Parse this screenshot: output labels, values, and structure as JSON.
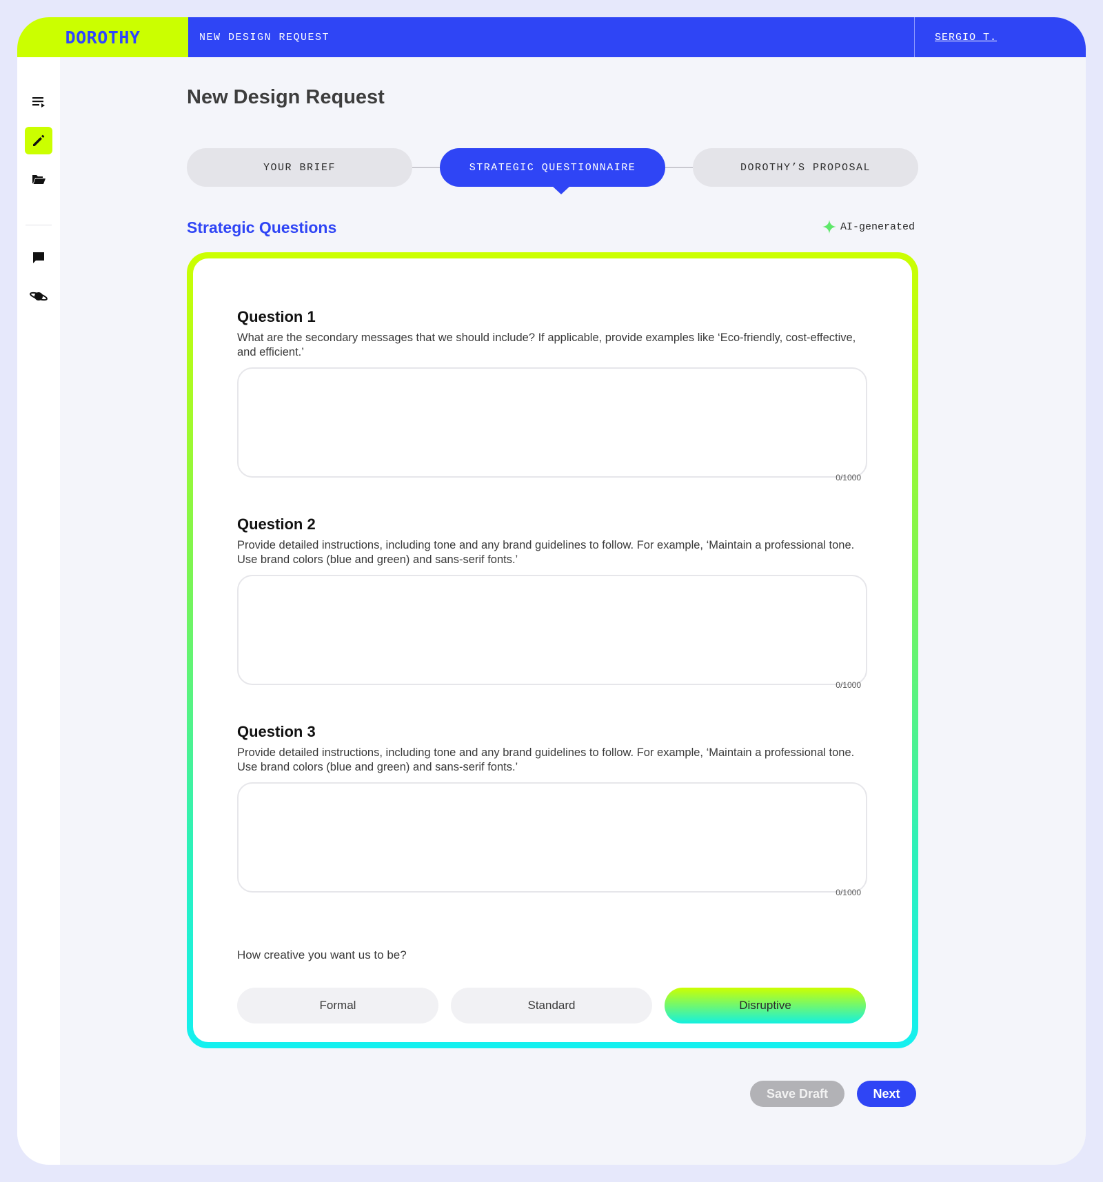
{
  "header": {
    "brand": "DOROTHY",
    "section": "NEW DESIGN REQUEST",
    "user": "SERGIO T."
  },
  "sidebar": {
    "items": [
      {
        "icon": "list-icon",
        "active": false
      },
      {
        "icon": "pencil-icon",
        "active": true
      },
      {
        "icon": "folder-icon",
        "active": false
      },
      {
        "icon": "chat-icon",
        "active": false
      },
      {
        "icon": "planet-icon",
        "active": false
      }
    ]
  },
  "page": {
    "title": "New Design Request"
  },
  "steps": [
    {
      "label": "YOUR BRIEF",
      "active": false
    },
    {
      "label": "STRATEGIC QUESTIONNAIRE",
      "active": true
    },
    {
      "label": "DOROTHY’S PROPOSAL",
      "active": false
    }
  ],
  "section": {
    "title": "Strategic Questions",
    "ai_label": "AI-generated"
  },
  "questions": [
    {
      "title": "Question 1",
      "description": "What are the secondary messages that we should include? If applicable, provide examples like ‘Eco-friendly, cost-effective, and efficient.’",
      "value": "",
      "counter": "0/1000"
    },
    {
      "title": "Question 2",
      "description": "Provide detailed instructions, including tone and any brand guidelines to follow. For example, ‘Maintain a professional tone. Use brand colors (blue and green) and sans-serif fonts.’",
      "value": "",
      "counter": "0/1000"
    },
    {
      "title": "Question 3",
      "description": "Provide detailed instructions, including tone and any brand guidelines to follow. For example, ‘Maintain a professional tone. Use brand colors (blue and green) and sans-serif fonts.’",
      "value": "",
      "counter": "0/1000"
    }
  ],
  "creativity": {
    "question": "How creative you want us to be?",
    "options": [
      "Formal",
      "Standard",
      "Disruptive"
    ],
    "selected": "Disruptive"
  },
  "actions": {
    "save_draft": "Save Draft",
    "next": "Next"
  },
  "colors": {
    "brand_blue": "#2f45f5",
    "brand_lime": "#cbff00",
    "gradient_end": "#13f0f0"
  }
}
